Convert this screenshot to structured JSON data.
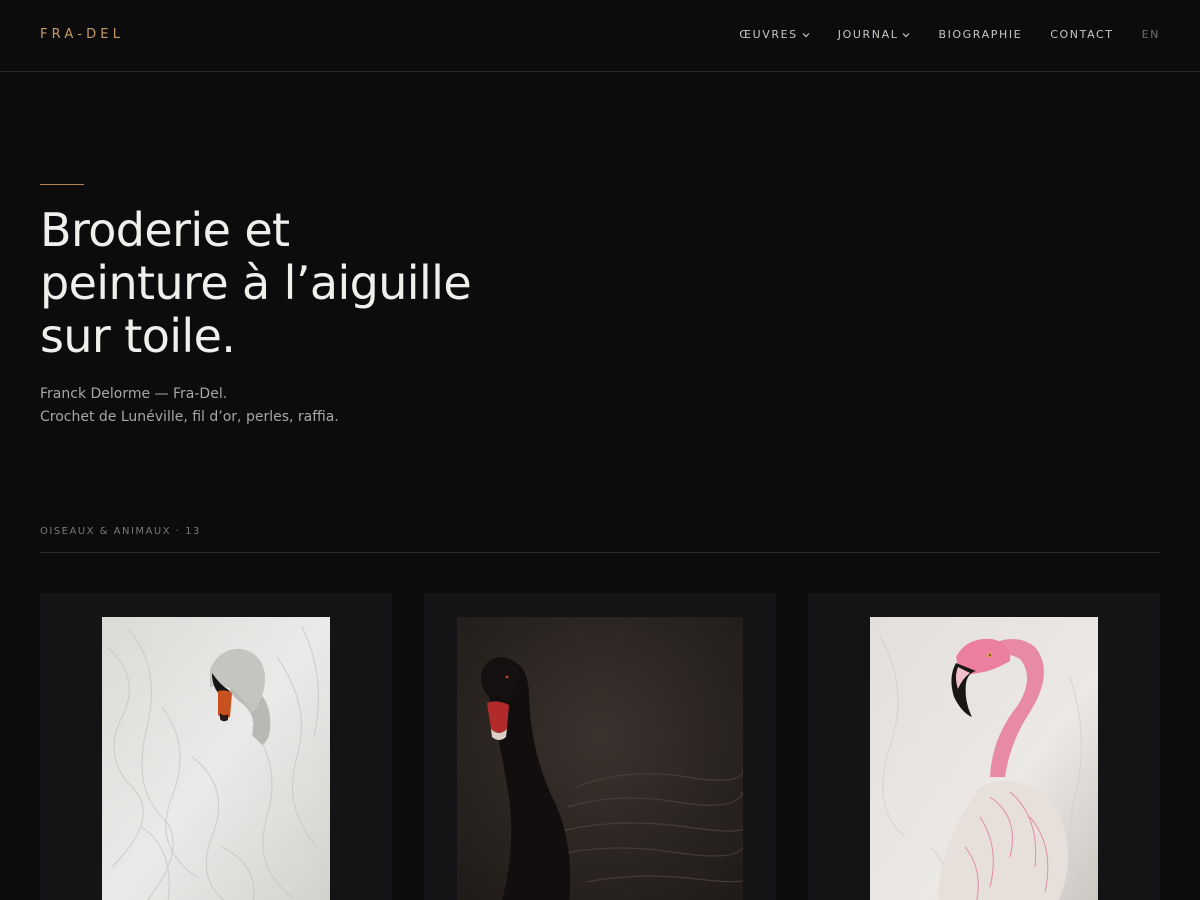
{
  "header": {
    "logo": "FRA-DEL",
    "nav": [
      {
        "label": "ŒUVRES",
        "has_dropdown": true
      },
      {
        "label": "JOURNAL",
        "has_dropdown": true
      },
      {
        "label": "BIOGRAPHIE",
        "has_dropdown": false
      },
      {
        "label": "CONTACT",
        "has_dropdown": false
      }
    ],
    "lang": "EN"
  },
  "hero": {
    "title_lines": [
      "Broderie et",
      "peinture à l’aiguille",
      "sur toile."
    ],
    "subtitle_lines": [
      "Franck Delorme — Fra-Del.",
      "Crochet de Lunéville, fil d’or, perles, raffia."
    ]
  },
  "section": {
    "label": "OISEAUX & ANIMAUX · 13"
  },
  "artworks": [
    {
      "subject": "white swan",
      "icon": "white-swan-artwork"
    },
    {
      "subject": "black swan",
      "icon": "black-swan-artwork"
    },
    {
      "subject": "pink flamingo",
      "icon": "flamingo-artwork"
    }
  ],
  "colors": {
    "background": "#0c0c0d",
    "accent": "#c79a62",
    "card": "#141417",
    "text": "#f1efeb"
  }
}
